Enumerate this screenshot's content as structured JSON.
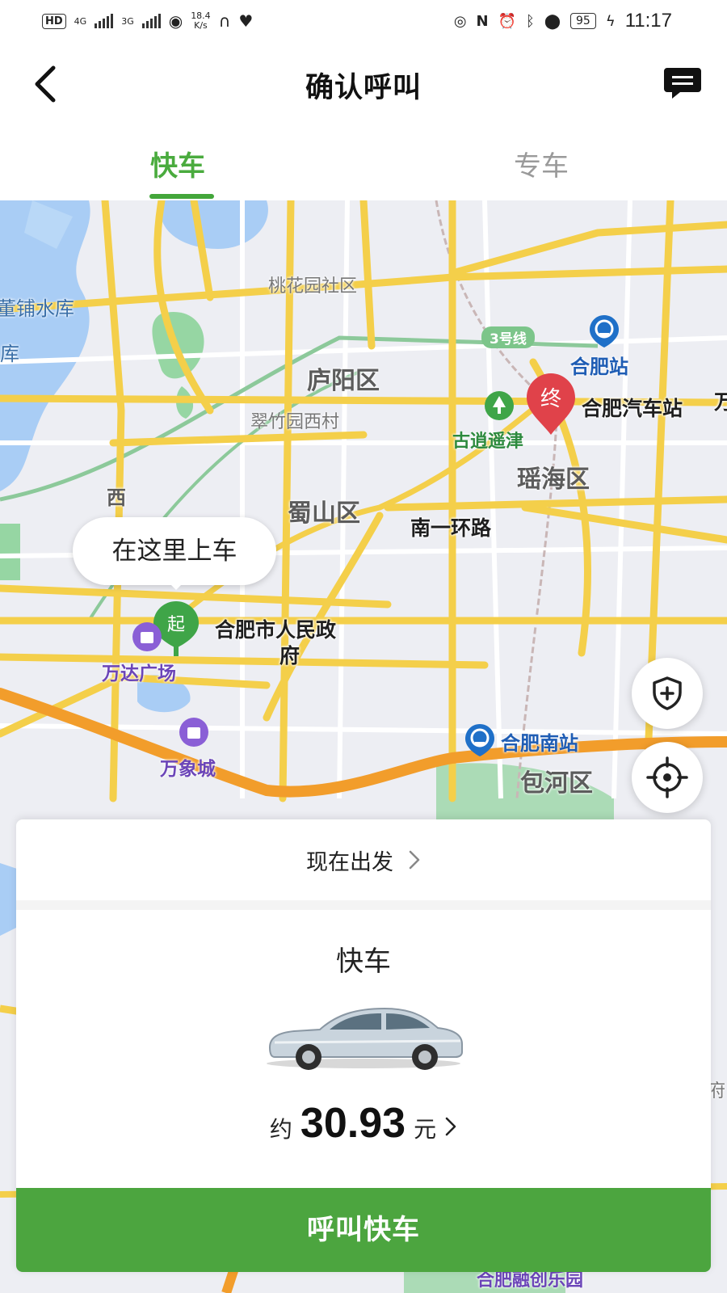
{
  "status_bar": {
    "hd": "HD",
    "sim1": "4G",
    "sim2": "3G",
    "net_speed_value": "18.4",
    "net_speed_unit": "K/s",
    "battery": "95",
    "time": "11:17"
  },
  "header": {
    "title": "确认呼叫"
  },
  "tabs": [
    {
      "label": "快车",
      "selected": true
    },
    {
      "label": "专车",
      "selected": false
    }
  ],
  "map": {
    "pickup_hint": "在这里上车",
    "start_marker": "起",
    "end_marker": "终",
    "labels": {
      "taohuayuan": "桃花园社区",
      "reservoir": "董铺水库",
      "reservoir2": "库",
      "luyang": "庐阳区",
      "cuizhuyuan": "翠竹园西村",
      "hefei_station": "合肥站",
      "hefei_bus_station": "合肥汽车站",
      "wan_cut": "万",
      "gudao": "古逍遥津",
      "yaohai": "瑶海区",
      "xi": "西",
      "shushan": "蜀山区",
      "nanyihuan": "南一环路",
      "government": "合肥市人民政",
      "government2": "府",
      "wanda": "万达广场",
      "wanxiang": "万象城",
      "south_station": "合肥南站",
      "baohe": "包河区",
      "metro_line": "3号线",
      "fu_cut": "府",
      "bottom_cut": "合肥融创乐园"
    },
    "colors": {
      "road_major": "#f4cf4a",
      "highway": "#f29d2b",
      "water": "#a9cdf5",
      "green": "#7fcf8e",
      "start_pin": "#3fa548",
      "end_pin": "#e0424a"
    }
  },
  "card": {
    "depart": "现在出发",
    "vehicle": "快车",
    "price_prefix": "约",
    "price_value": "30.93",
    "price_unit": "元",
    "call_button": "呼叫快车"
  },
  "icons": {
    "back": "chevron-left-icon",
    "message": "message-icon",
    "safety": "shield-plus-icon",
    "locate": "crosshair-icon"
  }
}
